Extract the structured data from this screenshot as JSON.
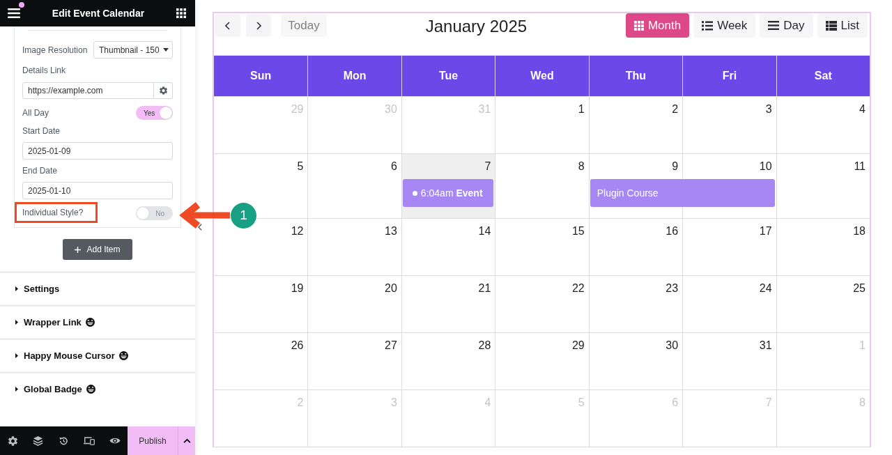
{
  "panel": {
    "title": "Edit Event Calendar",
    "fields": [
      {
        "kind": "select",
        "label": "Image Resolution",
        "value": "Thumbnail - 150",
        "highlighted": false
      },
      {
        "kind": "url",
        "label": "Details Link",
        "value": "https://example.com",
        "highlighted": false
      },
      {
        "kind": "toggle",
        "label": "All Day",
        "on": true,
        "text": "Yes",
        "highlighted": false
      },
      {
        "kind": "date",
        "label": "Start Date",
        "value": "2025-01-09",
        "highlighted": false
      },
      {
        "kind": "date",
        "label": "End Date",
        "value": "2025-01-10",
        "highlighted": false
      },
      {
        "kind": "toggle",
        "label": "Individual Style?",
        "on": false,
        "text": "No",
        "highlighted": true
      }
    ],
    "add_button": "Add Item",
    "sections": [
      {
        "title": "Settings",
        "pro_icon": false
      },
      {
        "title": "Wrapper Link",
        "pro_icon": true
      },
      {
        "title": "Happy Mouse Cursor",
        "pro_icon": true
      },
      {
        "title": "Global Badge",
        "pro_icon": true
      }
    ],
    "publish_button": "Publish"
  },
  "callout": {
    "number": "1"
  },
  "calendar": {
    "today_button": "Today",
    "title": "January 2025",
    "views": [
      {
        "label": "Month",
        "selected": true
      },
      {
        "label": "Week",
        "selected": false
      },
      {
        "label": "Day",
        "selected": false
      },
      {
        "label": "List",
        "selected": false
      }
    ],
    "weekdays": [
      "Sun",
      "Mon",
      "Tue",
      "Wed",
      "Thu",
      "Fri",
      "Sat"
    ],
    "weeks": [
      {
        "days": [
          {
            "label": "29",
            "other_month": true,
            "today": false
          },
          {
            "label": "30",
            "other_month": true,
            "today": false
          },
          {
            "label": "31",
            "other_month": true,
            "today": false
          },
          {
            "label": "1",
            "other_month": false,
            "today": false
          },
          {
            "label": "2",
            "other_month": false,
            "today": false
          },
          {
            "label": "3",
            "other_month": false,
            "today": false
          },
          {
            "label": "4",
            "other_month": false,
            "today": false
          }
        ]
      },
      {
        "days": [
          {
            "label": "5",
            "other_month": false,
            "today": false
          },
          {
            "label": "6",
            "other_month": false,
            "today": false
          },
          {
            "label": "7",
            "other_month": false,
            "today": true,
            "events": [
              {
                "kind": "timed",
                "time": "6:04am",
                "title": "Event",
                "continues": false
              }
            ]
          },
          {
            "label": "8",
            "other_month": false,
            "today": false
          },
          {
            "label": "9",
            "other_month": false,
            "today": false,
            "events": [
              {
                "kind": "all_day",
                "title": "Plugin Course",
                "continues": true
              }
            ]
          },
          {
            "label": "10",
            "other_month": false,
            "today": false
          },
          {
            "label": "11",
            "other_month": false,
            "today": false
          }
        ]
      },
      {
        "days": [
          {
            "label": "12",
            "other_month": false,
            "today": false
          },
          {
            "label": "13",
            "other_month": false,
            "today": false
          },
          {
            "label": "14",
            "other_month": false,
            "today": false
          },
          {
            "label": "15",
            "other_month": false,
            "today": false
          },
          {
            "label": "16",
            "other_month": false,
            "today": false
          },
          {
            "label": "17",
            "other_month": false,
            "today": false
          },
          {
            "label": "18",
            "other_month": false,
            "today": false
          }
        ]
      },
      {
        "days": [
          {
            "label": "19",
            "other_month": false,
            "today": false
          },
          {
            "label": "20",
            "other_month": false,
            "today": false
          },
          {
            "label": "21",
            "other_month": false,
            "today": false
          },
          {
            "label": "22",
            "other_month": false,
            "today": false
          },
          {
            "label": "23",
            "other_month": false,
            "today": false
          },
          {
            "label": "24",
            "other_month": false,
            "today": false
          },
          {
            "label": "25",
            "other_month": false,
            "today": false
          }
        ]
      },
      {
        "days": [
          {
            "label": "26",
            "other_month": false,
            "today": false
          },
          {
            "label": "27",
            "other_month": false,
            "today": false
          },
          {
            "label": "28",
            "other_month": false,
            "today": false
          },
          {
            "label": "29",
            "other_month": false,
            "today": false
          },
          {
            "label": "30",
            "other_month": false,
            "today": false
          },
          {
            "label": "31",
            "other_month": false,
            "today": false
          },
          {
            "label": "1",
            "other_month": true,
            "today": false
          }
        ]
      },
      {
        "days": [
          {
            "label": "2",
            "other_month": true,
            "today": false
          },
          {
            "label": "3",
            "other_month": true,
            "today": false
          },
          {
            "label": "4",
            "other_month": true,
            "today": false
          },
          {
            "label": "5",
            "other_month": true,
            "today": false
          },
          {
            "label": "6",
            "other_month": true,
            "today": false
          },
          {
            "label": "7",
            "other_month": true,
            "today": false
          },
          {
            "label": "8",
            "other_month": true,
            "today": false
          }
        ]
      }
    ]
  }
}
